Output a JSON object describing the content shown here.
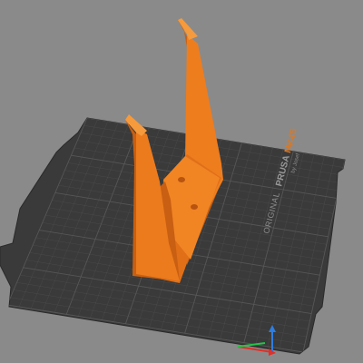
{
  "app": {
    "view": "3D plater view",
    "background_color": "#8a8a8a"
  },
  "bed": {
    "label_prefix": "ORIGINAL",
    "label_brand": "PRUSA",
    "label_model": "MK4S",
    "label_byline": "by Josef Prusa",
    "surface_color": "#3a3a3a",
    "grid_color": "#5a5a5a",
    "model_color": "#ea7a1c"
  },
  "axes": {
    "x_color": "#e0302a",
    "y_color": "#27c24a",
    "z_color": "#2f7de0"
  }
}
